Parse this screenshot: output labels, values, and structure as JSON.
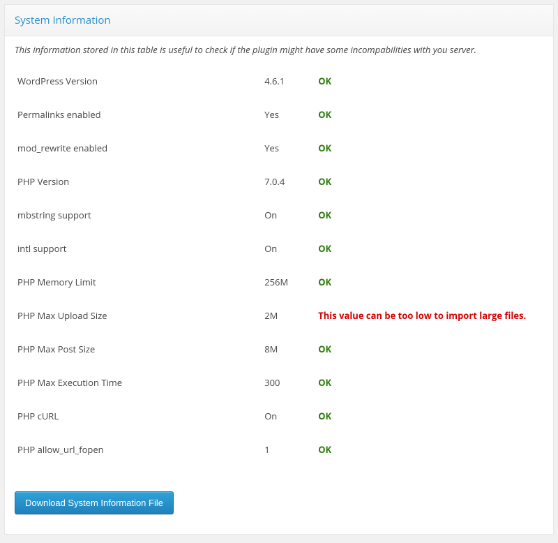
{
  "panel": {
    "title": "System Information",
    "description": "This information stored in this table is useful to check if the plugin might have some incompabilities with you server."
  },
  "rows": [
    {
      "label": "WordPress Version",
      "value": "4.6.1",
      "status": "OK",
      "ok": true
    },
    {
      "label": "Permalinks enabled",
      "value": "Yes",
      "status": "OK",
      "ok": true
    },
    {
      "label": "mod_rewrite enabled",
      "value": "Yes",
      "status": "OK",
      "ok": true
    },
    {
      "label": "PHP Version",
      "value": "7.0.4",
      "status": "OK",
      "ok": true
    },
    {
      "label": "mbstring support",
      "value": "On",
      "status": "OK",
      "ok": true
    },
    {
      "label": "intl support",
      "value": "On",
      "status": "OK",
      "ok": true
    },
    {
      "label": "PHP Memory Limit",
      "value": "256M",
      "status": "OK",
      "ok": true
    },
    {
      "label": "PHP Max Upload Size",
      "value": "2M",
      "status": "This value can be too low to import large files.",
      "ok": false
    },
    {
      "label": "PHP Max Post Size",
      "value": "8M",
      "status": "OK",
      "ok": true
    },
    {
      "label": "PHP Max Execution Time",
      "value": "300",
      "status": "OK",
      "ok": true
    },
    {
      "label": "PHP cURL",
      "value": "On",
      "status": "OK",
      "ok": true
    },
    {
      "label": "PHP allow_url_fopen",
      "value": "1",
      "status": "OK",
      "ok": true
    }
  ],
  "download_button_label": "Download System Information File"
}
